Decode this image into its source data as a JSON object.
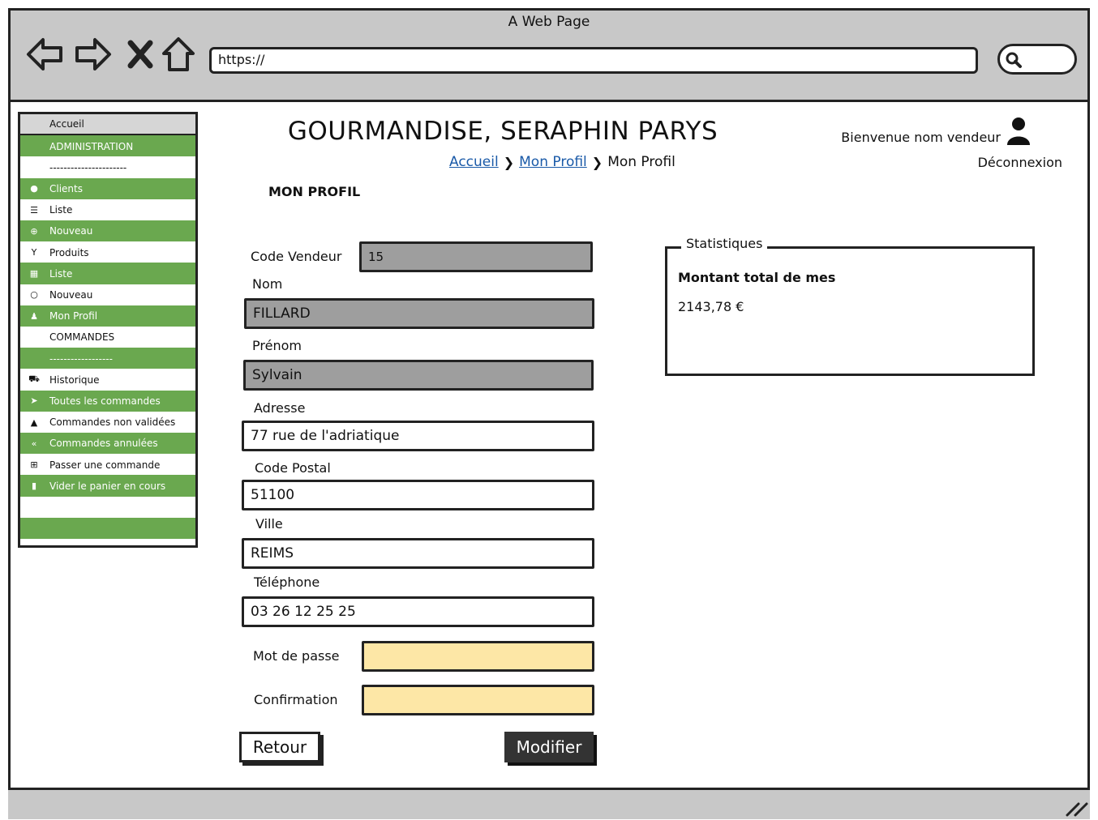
{
  "window": {
    "title": "A Web Page"
  },
  "browser": {
    "url": "https://"
  },
  "sidebar": {
    "items": [
      {
        "label": "Accueil",
        "style": "gray",
        "icon": ""
      },
      {
        "label": "ADMINISTRATION",
        "style": "green",
        "icon": ""
      },
      {
        "label": "----------------------",
        "style": "white",
        "icon": ""
      },
      {
        "label": "Clients",
        "style": "green",
        "icon": "circle-icon"
      },
      {
        "label": "Liste",
        "style": "white",
        "icon": "list-icon"
      },
      {
        "label": "Nouveau",
        "style": "green",
        "icon": "add-circle-icon"
      },
      {
        "label": "Produits",
        "style": "white",
        "icon": "cocktail-icon"
      },
      {
        "label": "Liste",
        "style": "green",
        "icon": "grid-icon"
      },
      {
        "label": "Nouveau",
        "style": "white",
        "icon": "ring-icon"
      },
      {
        "label": "Mon Profil",
        "style": "green",
        "icon": "user-icon"
      },
      {
        "label": "COMMANDES",
        "style": "white",
        "icon": ""
      },
      {
        "label": "------------------",
        "style": "green",
        "icon": ""
      },
      {
        "label": "Historique",
        "style": "white",
        "icon": "cart-icon"
      },
      {
        "label": "Toutes les commandes",
        "style": "green",
        "icon": "send-icon"
      },
      {
        "label": "Commandes non validées",
        "style": "white",
        "icon": "warning-icon"
      },
      {
        "label": "Commandes annulées",
        "style": "green",
        "icon": "double-chevron-left-icon"
      },
      {
        "label": "Passer une commande",
        "style": "white",
        "icon": "plus-square-icon"
      },
      {
        "label": "Vider le panier en cours",
        "style": "green",
        "icon": "trash-icon"
      },
      {
        "label": "",
        "style": "white",
        "icon": ""
      },
      {
        "label": "",
        "style": "green",
        "icon": ""
      }
    ]
  },
  "header": {
    "title": "GOURMANDISE, SERAPHIN PARYS",
    "welcome": "Bienvenue nom vendeur",
    "logout": "Déconnexion",
    "breadcrumb": {
      "home": "Accueil",
      "profile_link": "Mon Profil",
      "current": "Mon Profil"
    }
  },
  "section_title": "MON PROFIL",
  "form": {
    "code_vendeur": {
      "label": "Code Vendeur",
      "value": "15"
    },
    "nom": {
      "label": "Nom",
      "value": "FILLARD"
    },
    "prenom": {
      "label": "Prénom",
      "value": "Sylvain"
    },
    "adresse": {
      "label": "Adresse",
      "value": "77 rue de l'adriatique"
    },
    "code_postal": {
      "label": "Code Postal",
      "value": "51100"
    },
    "ville": {
      "label": "Ville",
      "value": "REIMS"
    },
    "telephone": {
      "label": "Téléphone",
      "value": "03 26 12 25 25"
    },
    "mot_de_passe": {
      "label": "Mot de passe",
      "value": ""
    },
    "confirmation": {
      "label": "Confirmation",
      "value": ""
    },
    "back_label": "Retour",
    "submit_label": "Modifier"
  },
  "stats": {
    "legend": "Statistiques",
    "label": "Montant total de mes",
    "value": "2143,78 €"
  },
  "colors": {
    "accent_green": "#6aa84f",
    "readonly_gray": "#9e9e9e",
    "password_yellow": "#fde7a6"
  }
}
